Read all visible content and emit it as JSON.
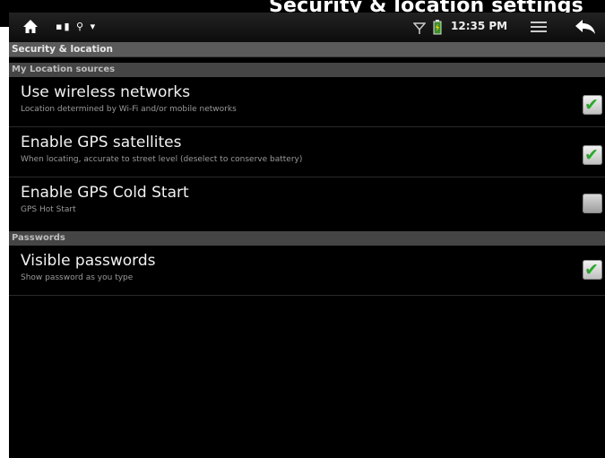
{
  "caption": "Security & location settings",
  "status_bar": {
    "time": "12:35 PM",
    "icons": [
      "home-icon",
      "usb-icon",
      "signal-icon",
      "battery-icon",
      "menu-icon",
      "back-icon"
    ]
  },
  "title": "Security & location",
  "sections": [
    {
      "header": "My Location sources"
    },
    {
      "header": "Passwords"
    }
  ],
  "rows": [
    {
      "title": "Use wireless networks",
      "summary": "Location determined by Wi-Fi and/or mobile networks",
      "checked": true
    },
    {
      "title": "Enable GPS satellites",
      "summary": "When locating, accurate to street level (deselect to conserve battery)",
      "checked": true
    },
    {
      "title": "Enable GPS Cold Start",
      "summary": "GPS Hot Start",
      "checked": false
    },
    {
      "title": "Visible passwords",
      "summary": "Show password as you type",
      "checked": true
    }
  ],
  "colors": {
    "check": "#2ea52e",
    "status_bg": "#111111",
    "section_bg": "#454545"
  }
}
